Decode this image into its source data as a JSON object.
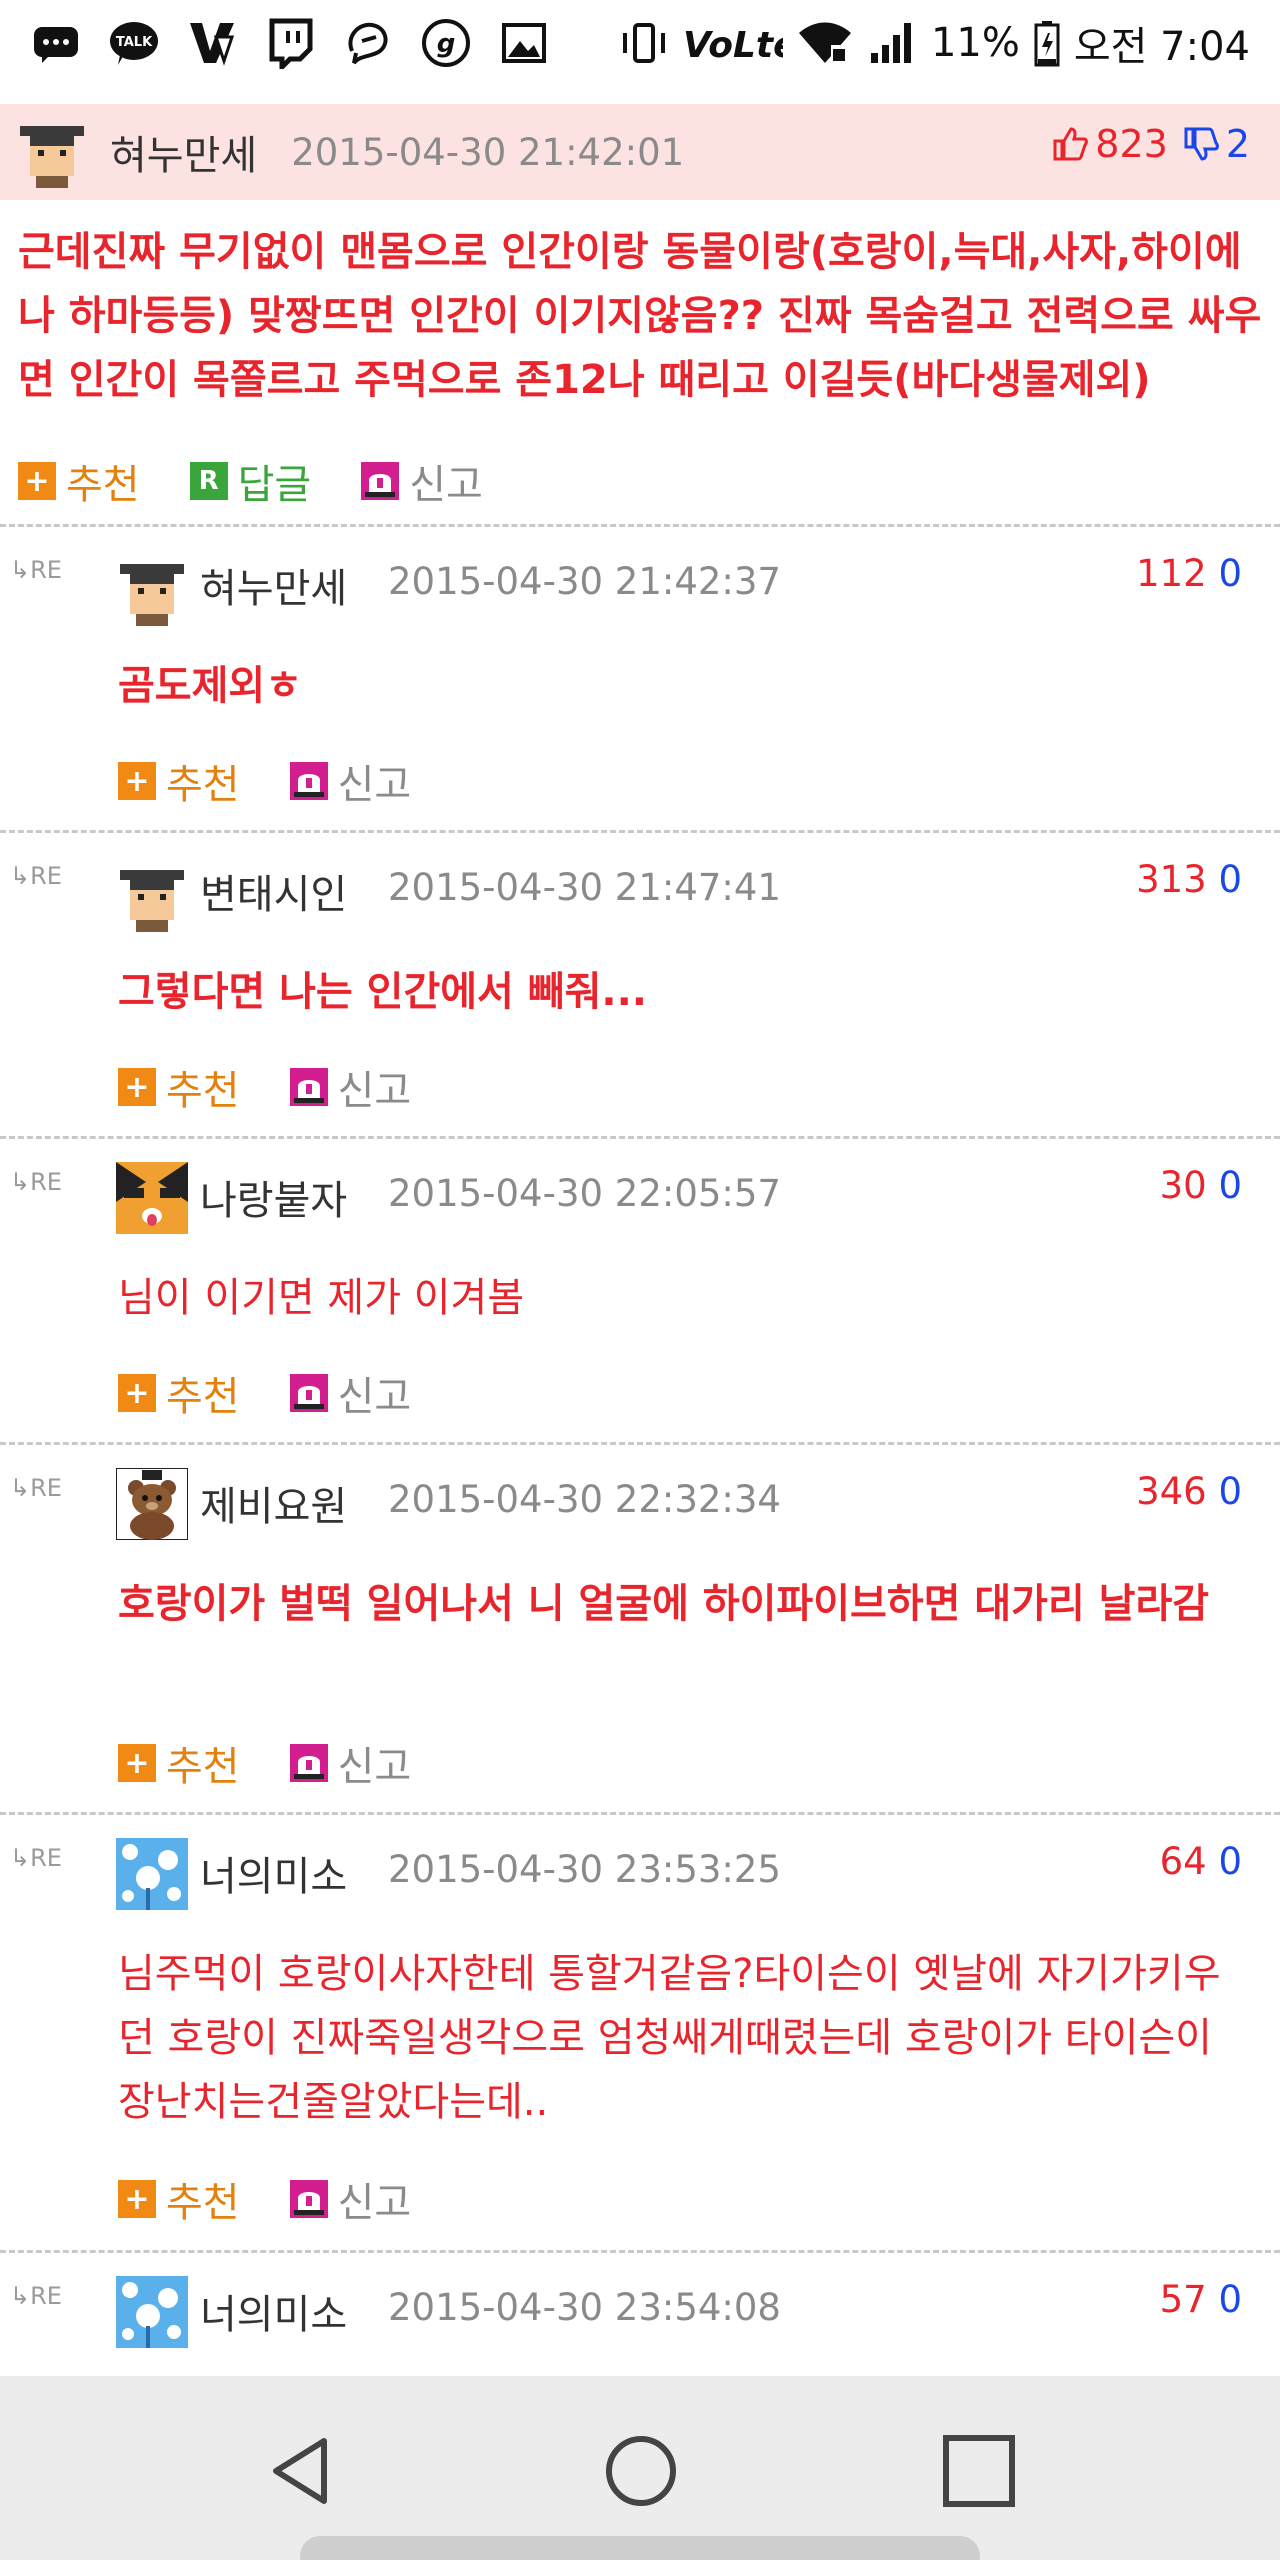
{
  "status_bar": {
    "icons": [
      "message-icon",
      "kakaotalk-icon",
      "vlive-icon",
      "twitch-icon",
      "chat-icon",
      "g-icon",
      "gallery-icon"
    ],
    "talk_label": "TALK",
    "battery": "11%",
    "time": "오전 7:04"
  },
  "post": {
    "nickname": "혀누만세",
    "date": "2015-04-30 21:42:01",
    "likes": "823",
    "dislikes": "2",
    "body": "근데진짜 무기없이 맨몸으로 인간이랑 동물이랑(호랑이,늑대,사자,하이에나 하마등등) 맞짱뜨면 인간이 이기지않음?? 진짜 목숨걸고 전력으로 싸우면 인간이 목쫄르고 주먹으로 존12나 때리고 이길듯(바다생물제외)",
    "recommend_label": "추천",
    "reply_label": "답글",
    "report_label": "신고"
  },
  "comments": [
    {
      "nickname": "혀누만세",
      "date": "2015-04-30 21:42:37",
      "likes": "112",
      "dislikes": "0",
      "body": "곰도제외ㅎ",
      "recommend_label": "추천",
      "report_label": "신고"
    },
    {
      "nickname": "변태시인",
      "date": "2015-04-30 21:47:41",
      "likes": "313",
      "dislikes": "0",
      "body": "그렇다면 나는 인간에서 빼줘...",
      "recommend_label": "추천",
      "report_label": "신고"
    },
    {
      "nickname": "나랑붙자",
      "date": "2015-04-30 22:05:57",
      "likes": "30",
      "dislikes": "0",
      "body": "님이 이기면 제가 이겨봄",
      "recommend_label": "추천",
      "report_label": "신고"
    },
    {
      "nickname": "제비요원",
      "date": "2015-04-30 22:32:34",
      "likes": "346",
      "dislikes": "0",
      "body": "호랑이가 벌떡 일어나서 니 얼굴에 하이파이브하면 대가리 날라감",
      "recommend_label": "추천",
      "report_label": "신고"
    },
    {
      "nickname": "너의미소",
      "date": "2015-04-30 23:53:25",
      "likes": "64",
      "dislikes": "0",
      "body": "님주먹이 호랑이사자한테 통할거같음?타이슨이 옛날에 자기가키우던 호랑이 진짜죽일생각으로 엄청쌔게때렸는데 호랑이가 타이슨이 장난치는건줄알았다는데..",
      "recommend_label": "추천",
      "report_label": "신고"
    },
    {
      "nickname": "너의미소",
      "date": "2015-04-30 23:54:08",
      "likes": "57",
      "dislikes": "0"
    }
  ],
  "re_label": "RE",
  "colors": {
    "accent_red": "#e8242c",
    "accent_blue": "#1a47e8",
    "header_bg": "#fde2e2",
    "recommend": "#f08a14"
  }
}
